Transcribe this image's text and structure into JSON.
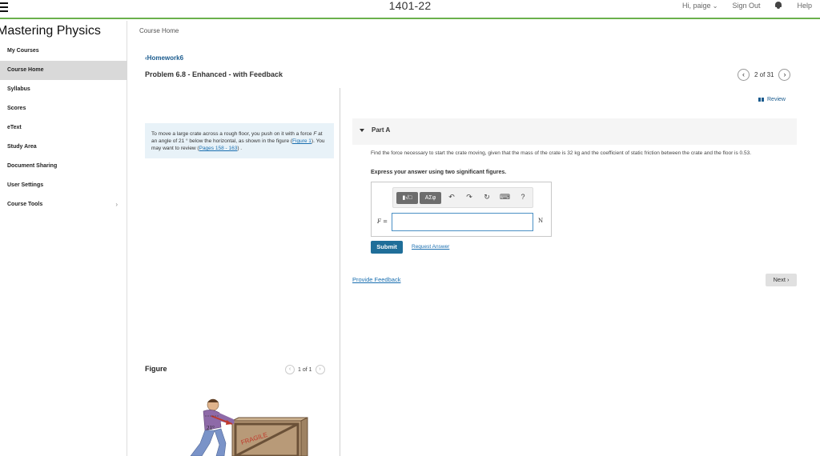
{
  "header": {
    "course_code": "1401-22",
    "greeting": "Hi, paige",
    "sign_out": "Sign Out",
    "help": "Help",
    "accent_color": "#6ab04c"
  },
  "sidebar": {
    "brand": "Mastering Physics",
    "items": [
      {
        "label": "My Courses",
        "active": false
      },
      {
        "label": "Course Home",
        "active": true
      },
      {
        "label": "Syllabus",
        "active": false
      },
      {
        "label": "Scores",
        "active": false
      },
      {
        "label": "eText",
        "active": false
      },
      {
        "label": "Study Area",
        "active": false
      },
      {
        "label": "Document Sharing",
        "active": false
      },
      {
        "label": "User Settings",
        "active": false
      },
      {
        "label": "Course Tools",
        "active": false,
        "chevron": "›"
      }
    ]
  },
  "main": {
    "breadcrumb": "Course Home",
    "back_link": "Homework6",
    "problem_title": "Problem 6.8 - Enhanced - with Feedback",
    "pager": {
      "prev": "‹",
      "text": "2 of 31",
      "next": "›"
    },
    "review": "Review",
    "intro": {
      "text_1": "To move a large crate across a rough floor, you push on it with a force ",
      "force_symbol": "F",
      "text_2": " at an angle of 21 ° below the horizontal, as shown in the figure (",
      "figure_link": "Figure 1",
      "text_3": "). You may want to review (",
      "pages_link": "Pages 158 - 163",
      "text_4": ") ."
    },
    "part": {
      "label": "Part A",
      "question": "Find the force necessary to start the crate moving, given that the mass of the crate is 32 kg and the coefficient of static friction between the crate and the floor is 0.53.",
      "instruction": "Express your answer using two significant figures.",
      "toolbar": {
        "template_btn": "▮√□",
        "symbols_btn": "ΑΣφ",
        "undo": "↶",
        "redo": "↷",
        "reset": "↻",
        "keyboard": "⌨",
        "help": "?"
      },
      "variable": "F =",
      "answer_value": "",
      "unit": "N",
      "submit": "Submit",
      "request_answer": "Request Answer"
    },
    "provide_feedback": "Provide Feedback",
    "next": "Next ›"
  },
  "figure": {
    "title": "Figure",
    "pager": {
      "prev": "‹",
      "text": "1 of 1",
      "next": "›"
    },
    "angle_label": "21°",
    "crate_label": "FRAGILE"
  }
}
